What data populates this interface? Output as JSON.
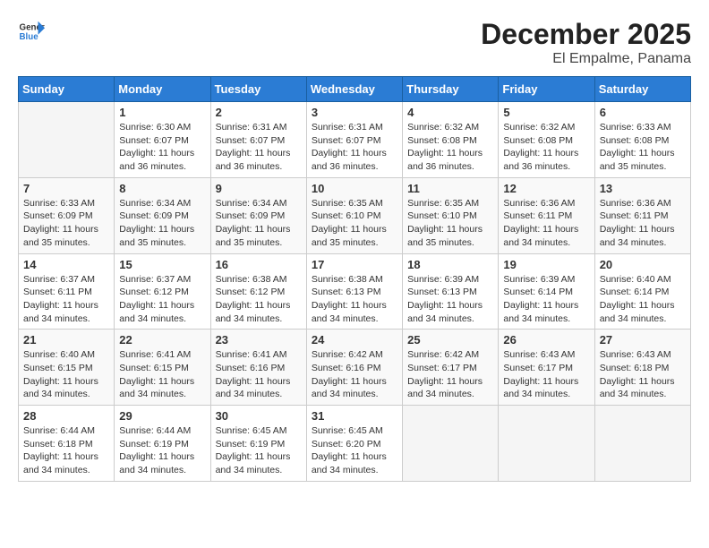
{
  "logo": {
    "general": "General",
    "blue": "Blue"
  },
  "title": "December 2025",
  "subtitle": "El Empalme, Panama",
  "days_of_week": [
    "Sunday",
    "Monday",
    "Tuesday",
    "Wednesday",
    "Thursday",
    "Friday",
    "Saturday"
  ],
  "weeks": [
    [
      {
        "num": "",
        "sunrise": "",
        "sunset": "",
        "daylight": "",
        "empty": true
      },
      {
        "num": "1",
        "sunrise": "Sunrise: 6:30 AM",
        "sunset": "Sunset: 6:07 PM",
        "daylight": "Daylight: 11 hours and 36 minutes."
      },
      {
        "num": "2",
        "sunrise": "Sunrise: 6:31 AM",
        "sunset": "Sunset: 6:07 PM",
        "daylight": "Daylight: 11 hours and 36 minutes."
      },
      {
        "num": "3",
        "sunrise": "Sunrise: 6:31 AM",
        "sunset": "Sunset: 6:07 PM",
        "daylight": "Daylight: 11 hours and 36 minutes."
      },
      {
        "num": "4",
        "sunrise": "Sunrise: 6:32 AM",
        "sunset": "Sunset: 6:08 PM",
        "daylight": "Daylight: 11 hours and 36 minutes."
      },
      {
        "num": "5",
        "sunrise": "Sunrise: 6:32 AM",
        "sunset": "Sunset: 6:08 PM",
        "daylight": "Daylight: 11 hours and 36 minutes."
      },
      {
        "num": "6",
        "sunrise": "Sunrise: 6:33 AM",
        "sunset": "Sunset: 6:08 PM",
        "daylight": "Daylight: 11 hours and 35 minutes."
      }
    ],
    [
      {
        "num": "7",
        "sunrise": "Sunrise: 6:33 AM",
        "sunset": "Sunset: 6:09 PM",
        "daylight": "Daylight: 11 hours and 35 minutes."
      },
      {
        "num": "8",
        "sunrise": "Sunrise: 6:34 AM",
        "sunset": "Sunset: 6:09 PM",
        "daylight": "Daylight: 11 hours and 35 minutes."
      },
      {
        "num": "9",
        "sunrise": "Sunrise: 6:34 AM",
        "sunset": "Sunset: 6:09 PM",
        "daylight": "Daylight: 11 hours and 35 minutes."
      },
      {
        "num": "10",
        "sunrise": "Sunrise: 6:35 AM",
        "sunset": "Sunset: 6:10 PM",
        "daylight": "Daylight: 11 hours and 35 minutes."
      },
      {
        "num": "11",
        "sunrise": "Sunrise: 6:35 AM",
        "sunset": "Sunset: 6:10 PM",
        "daylight": "Daylight: 11 hours and 35 minutes."
      },
      {
        "num": "12",
        "sunrise": "Sunrise: 6:36 AM",
        "sunset": "Sunset: 6:11 PM",
        "daylight": "Daylight: 11 hours and 34 minutes."
      },
      {
        "num": "13",
        "sunrise": "Sunrise: 6:36 AM",
        "sunset": "Sunset: 6:11 PM",
        "daylight": "Daylight: 11 hours and 34 minutes."
      }
    ],
    [
      {
        "num": "14",
        "sunrise": "Sunrise: 6:37 AM",
        "sunset": "Sunset: 6:11 PM",
        "daylight": "Daylight: 11 hours and 34 minutes."
      },
      {
        "num": "15",
        "sunrise": "Sunrise: 6:37 AM",
        "sunset": "Sunset: 6:12 PM",
        "daylight": "Daylight: 11 hours and 34 minutes."
      },
      {
        "num": "16",
        "sunrise": "Sunrise: 6:38 AM",
        "sunset": "Sunset: 6:12 PM",
        "daylight": "Daylight: 11 hours and 34 minutes."
      },
      {
        "num": "17",
        "sunrise": "Sunrise: 6:38 AM",
        "sunset": "Sunset: 6:13 PM",
        "daylight": "Daylight: 11 hours and 34 minutes."
      },
      {
        "num": "18",
        "sunrise": "Sunrise: 6:39 AM",
        "sunset": "Sunset: 6:13 PM",
        "daylight": "Daylight: 11 hours and 34 minutes."
      },
      {
        "num": "19",
        "sunrise": "Sunrise: 6:39 AM",
        "sunset": "Sunset: 6:14 PM",
        "daylight": "Daylight: 11 hours and 34 minutes."
      },
      {
        "num": "20",
        "sunrise": "Sunrise: 6:40 AM",
        "sunset": "Sunset: 6:14 PM",
        "daylight": "Daylight: 11 hours and 34 minutes."
      }
    ],
    [
      {
        "num": "21",
        "sunrise": "Sunrise: 6:40 AM",
        "sunset": "Sunset: 6:15 PM",
        "daylight": "Daylight: 11 hours and 34 minutes."
      },
      {
        "num": "22",
        "sunrise": "Sunrise: 6:41 AM",
        "sunset": "Sunset: 6:15 PM",
        "daylight": "Daylight: 11 hours and 34 minutes."
      },
      {
        "num": "23",
        "sunrise": "Sunrise: 6:41 AM",
        "sunset": "Sunset: 6:16 PM",
        "daylight": "Daylight: 11 hours and 34 minutes."
      },
      {
        "num": "24",
        "sunrise": "Sunrise: 6:42 AM",
        "sunset": "Sunset: 6:16 PM",
        "daylight": "Daylight: 11 hours and 34 minutes."
      },
      {
        "num": "25",
        "sunrise": "Sunrise: 6:42 AM",
        "sunset": "Sunset: 6:17 PM",
        "daylight": "Daylight: 11 hours and 34 minutes."
      },
      {
        "num": "26",
        "sunrise": "Sunrise: 6:43 AM",
        "sunset": "Sunset: 6:17 PM",
        "daylight": "Daylight: 11 hours and 34 minutes."
      },
      {
        "num": "27",
        "sunrise": "Sunrise: 6:43 AM",
        "sunset": "Sunset: 6:18 PM",
        "daylight": "Daylight: 11 hours and 34 minutes."
      }
    ],
    [
      {
        "num": "28",
        "sunrise": "Sunrise: 6:44 AM",
        "sunset": "Sunset: 6:18 PM",
        "daylight": "Daylight: 11 hours and 34 minutes."
      },
      {
        "num": "29",
        "sunrise": "Sunrise: 6:44 AM",
        "sunset": "Sunset: 6:19 PM",
        "daylight": "Daylight: 11 hours and 34 minutes."
      },
      {
        "num": "30",
        "sunrise": "Sunrise: 6:45 AM",
        "sunset": "Sunset: 6:19 PM",
        "daylight": "Daylight: 11 hours and 34 minutes."
      },
      {
        "num": "31",
        "sunrise": "Sunrise: 6:45 AM",
        "sunset": "Sunset: 6:20 PM",
        "daylight": "Daylight: 11 hours and 34 minutes."
      },
      {
        "num": "",
        "sunrise": "",
        "sunset": "",
        "daylight": "",
        "empty": true
      },
      {
        "num": "",
        "sunrise": "",
        "sunset": "",
        "daylight": "",
        "empty": true
      },
      {
        "num": "",
        "sunrise": "",
        "sunset": "",
        "daylight": "",
        "empty": true
      }
    ]
  ]
}
